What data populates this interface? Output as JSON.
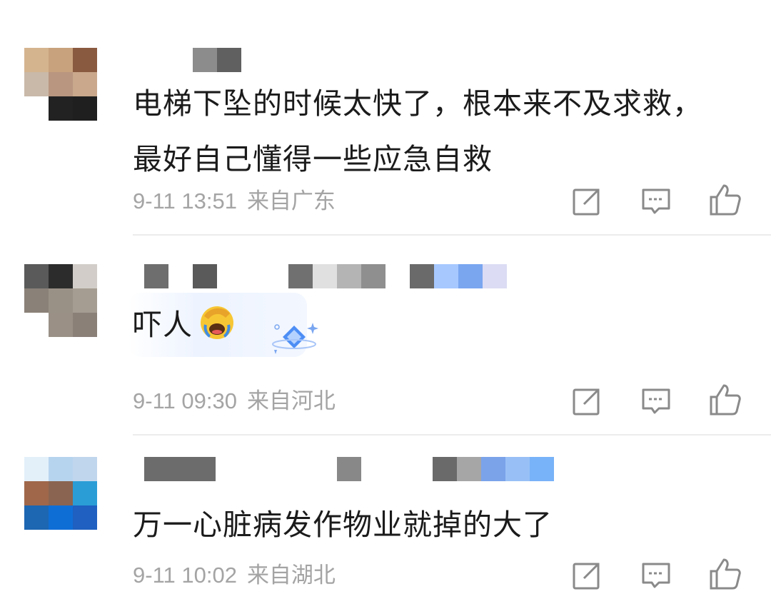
{
  "comments": [
    {
      "text": "电梯下坠的时候太快了，根本来不及求救，最好自己懂得一些应急自救",
      "time": "9-11 13:51",
      "location": "来自广东",
      "avatar_colors": [
        "#d4b48f",
        "#c8a27c",
        "#8a5a40",
        "#c9b9a8",
        "#b99680",
        "#c9a88c",
        "#ffffff",
        "#222222",
        "#1f1f1f"
      ],
      "name_blocks": [
        "#8c8c8c",
        "#606060"
      ]
    },
    {
      "text": "吓人",
      "emoji": "face-palm-laugh-emoji",
      "badge": "diamond-badge-icon",
      "time": "9-11 09:30",
      "location": "来自河北",
      "avatar_colors": [
        "#5a5a5a",
        "#2c2c2c",
        "#d2cdc8",
        "#8a8178",
        "#9a9186",
        "#a59d92",
        "#ffffff",
        "#9a9086",
        "#8a8078"
      ],
      "name_blocks": [
        "#6e6e6e",
        "#5a5a5a",
        "#707070",
        "#e0e0e0",
        "#b4b4b4",
        "#8f8f8f",
        "#6a6a6a",
        "#a6c8ff",
        "#7aa6f0",
        "#dcdcf4"
      ]
    },
    {
      "text": "万一心脏病发作物业就掉的大了",
      "time": "9-11 10:02",
      "location": "来自湖北",
      "avatar_colors": [
        "#e3f0fa",
        "#b7d4ef",
        "#c0d6ec",
        "#a0674a",
        "#8a6450",
        "#2a9dd6",
        "#1d66b2",
        "#0f6ed6",
        "#1f60c0"
      ],
      "name_blocks": [
        "#6c6c6c",
        "#6a6a6a",
        "#888888",
        "#6a6a6a",
        "#a6a6a6",
        "#7aa3ea",
        "#99c0f6",
        "#78b2f8"
      ]
    }
  ]
}
